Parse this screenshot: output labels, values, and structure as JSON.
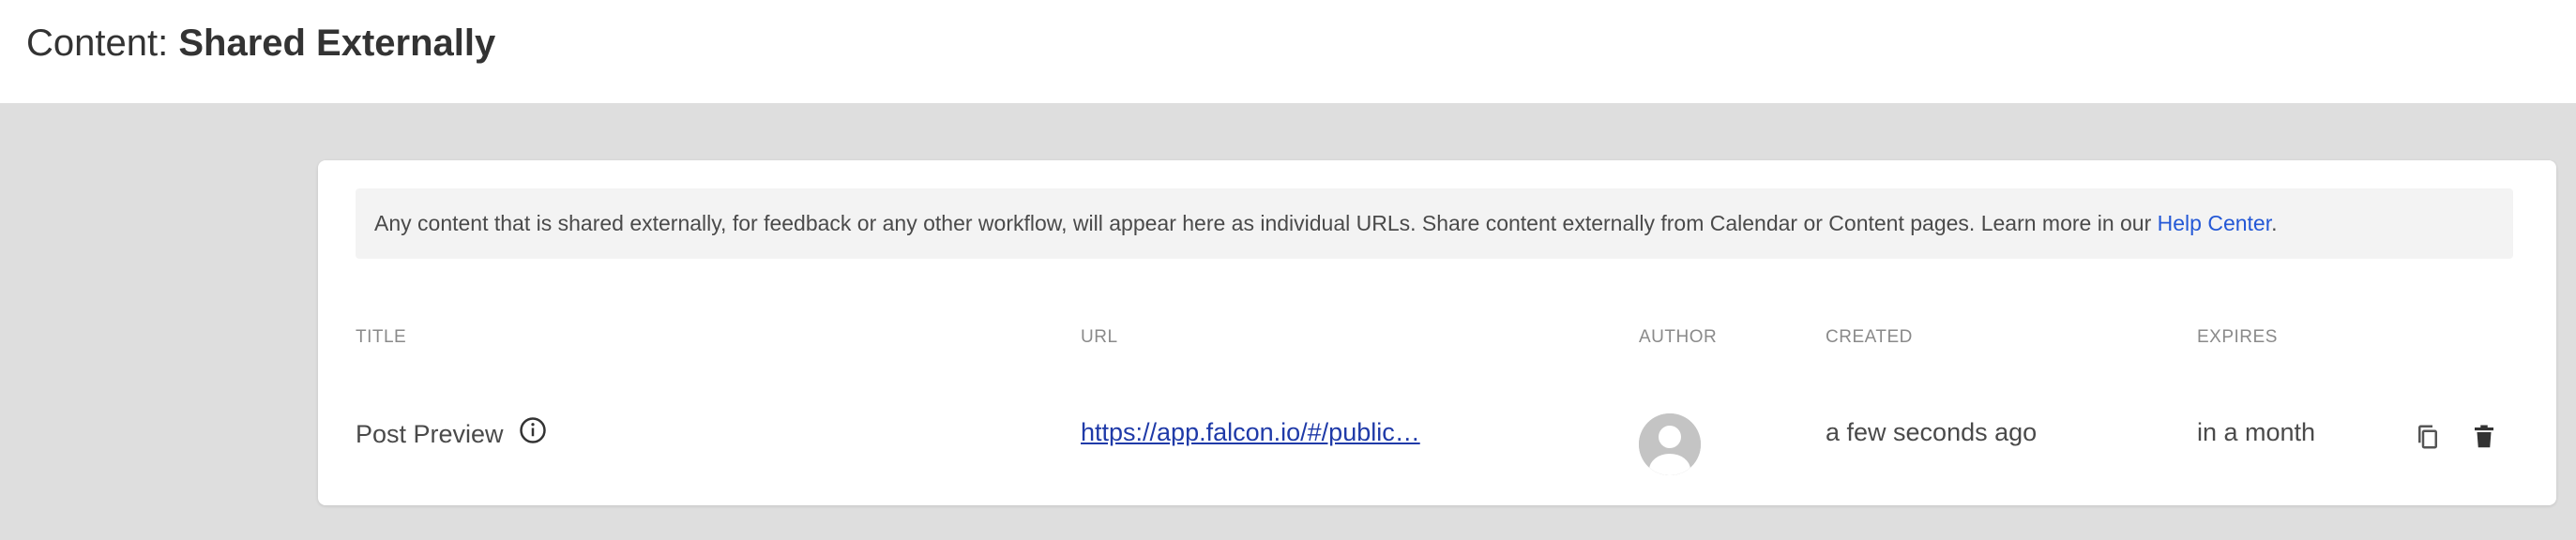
{
  "header": {
    "title_prefix": "Content: ",
    "title_main": "Shared Externally"
  },
  "banner": {
    "text": "Any content that is shared externally, for feedback or any other workflow, will appear here as individual URLs. Share content externally from Calendar or Content pages. Learn more in our ",
    "link_text": "Help Center",
    "suffix": "."
  },
  "table": {
    "columns": {
      "title": "TITLE",
      "url": "URL",
      "author": "AUTHOR",
      "created": "CREATED",
      "expires": "EXPIRES"
    },
    "rows": [
      {
        "title": "Post Preview",
        "url": "https://app.falcon.io/#/public…",
        "created": "a few seconds ago",
        "expires": "in a month"
      }
    ]
  },
  "colors": {
    "background": "#dedede",
    "card": "#ffffff",
    "banner": "#f3f3f3",
    "link": "#2458d6",
    "url_link": "#1f3aa8"
  },
  "icons": {
    "info": "info-circle-icon",
    "avatar": "user-avatar-placeholder",
    "copy": "copy-icon",
    "delete": "trash-icon"
  }
}
